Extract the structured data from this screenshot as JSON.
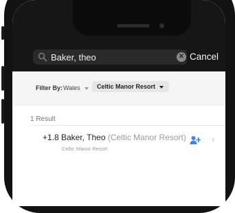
{
  "search": {
    "query": "Baker, theo",
    "cancel_label": "Cancel",
    "icon": "search-icon",
    "clear_icon": "clear-icon"
  },
  "filter": {
    "label": "Filter By:",
    "region": "Wales",
    "club": "Celtic Manor Resort"
  },
  "results": {
    "count_label": "1 Result",
    "items": [
      {
        "handicap": "+1.8",
        "name": "Baker, Theo",
        "club_inline": "(Celtic Manor Resort)",
        "subtitle": "Celtic Manor Resort",
        "action_icon": "add-player-icon"
      }
    ]
  },
  "colors": {
    "accent": "#3b82f6",
    "header_bg": "#161616",
    "filter_bg": "#f5f5f5"
  }
}
